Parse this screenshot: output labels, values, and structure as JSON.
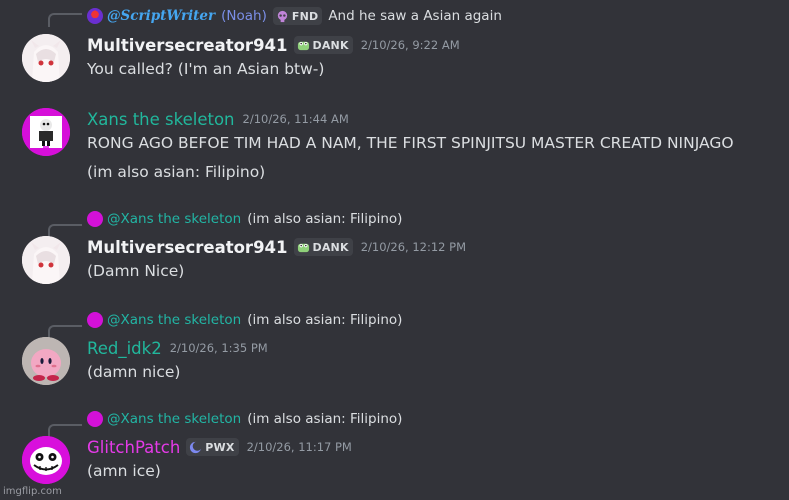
{
  "messages": [
    {
      "reply": {
        "name": "@ScriptWriter",
        "nick": "(Noah)",
        "tag": "FND",
        "text": "And he saw a Asian again"
      },
      "username": "Multiversecreator941",
      "tag": "DANK",
      "timestamp": "2/10/26, 9:22 AM",
      "lines": [
        "You called? (I'm an Asian btw-)"
      ]
    },
    {
      "username": "Xans the skeleton",
      "timestamp": "2/10/26, 11:44 AM",
      "lines": [
        "RONG AGO BEFOE TIM HAD A NAM, THE FIRST SPINJITSU MASTER CREATD NINJAGO",
        "(im also asian: Filipino)"
      ]
    },
    {
      "reply": {
        "name": "@Xans the skeleton",
        "text": "(im also asian: Filipino)"
      },
      "username": "Multiversecreator941",
      "tag": "DANK",
      "timestamp": "2/10/26, 12:12 PM",
      "lines": [
        "(Damn Nice)"
      ]
    },
    {
      "reply": {
        "name": "@Xans the skeleton",
        "text": "(im also asian: Filipino)"
      },
      "username": "Red_idk2",
      "timestamp": "2/10/26, 1:35 PM",
      "lines": [
        "(damn nice)"
      ]
    },
    {
      "reply": {
        "name": "@Xans the skeleton",
        "text": "(im also asian: Filipino)"
      },
      "username": "GlitchPatch",
      "tag": "PWX",
      "timestamp": "2/10/26, 11:17 PM",
      "lines": [
        "(amn ice)"
      ]
    }
  ],
  "watermark": "imgflip.com",
  "icons": {
    "dank_tag": "frog-icon",
    "fnd_tag": "skull-icon",
    "pwx_tag": "moon-icon"
  },
  "colors": {
    "background": "#323339",
    "mention_teal": "#22b5a4",
    "username_teal": "#21b79c",
    "username_magenta": "#e53ae8"
  }
}
